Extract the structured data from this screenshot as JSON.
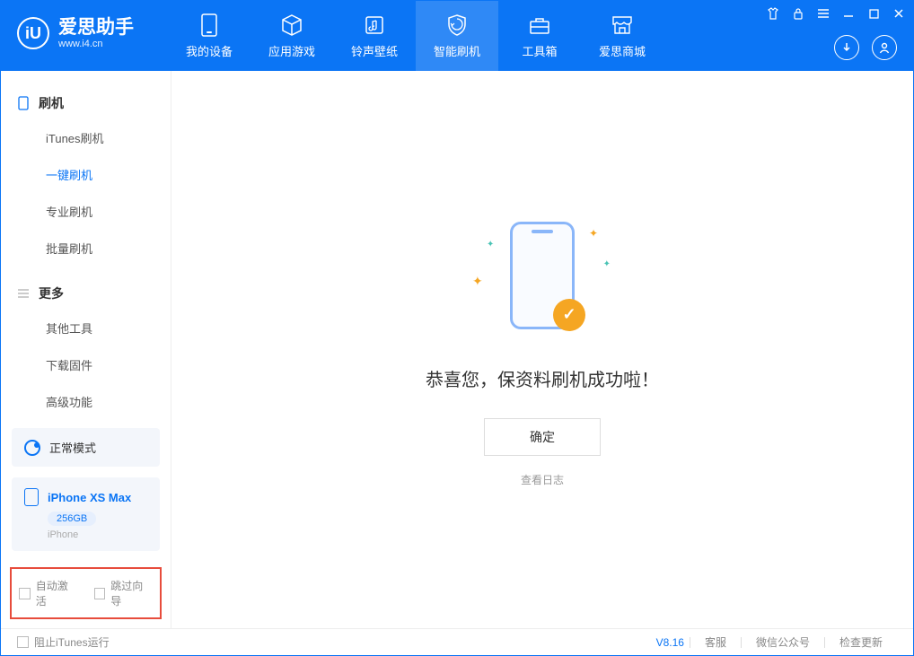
{
  "app": {
    "title": "爱思助手",
    "subtitle": "www.i4.cn",
    "logo_letter": "iU"
  },
  "nav": {
    "tabs": [
      {
        "label": "我的设备",
        "icon": "device"
      },
      {
        "label": "应用游戏",
        "icon": "cube"
      },
      {
        "label": "铃声壁纸",
        "icon": "music-folder"
      },
      {
        "label": "智能刷机",
        "icon": "shield",
        "active": true
      },
      {
        "label": "工具箱",
        "icon": "toolbox"
      },
      {
        "label": "爱思商城",
        "icon": "store"
      }
    ]
  },
  "sidebar": {
    "section1": {
      "title": "刷机"
    },
    "items1": [
      {
        "label": "iTunes刷机"
      },
      {
        "label": "一键刷机",
        "active": true
      },
      {
        "label": "专业刷机"
      },
      {
        "label": "批量刷机"
      }
    ],
    "section2": {
      "title": "更多"
    },
    "items2": [
      {
        "label": "其他工具"
      },
      {
        "label": "下载固件"
      },
      {
        "label": "高级功能"
      }
    ],
    "status": {
      "label": "正常模式"
    },
    "device": {
      "name": "iPhone XS Max",
      "storage": "256GB",
      "type": "iPhone"
    },
    "options": {
      "auto_activate": "自动激活",
      "skip_guide": "跳过向导"
    }
  },
  "main": {
    "success_title": "恭喜您，保资料刷机成功啦！",
    "confirm_label": "确定",
    "log_link": "查看日志"
  },
  "footer": {
    "block_itunes": "阻止iTunes运行",
    "version": "V8.16",
    "links": {
      "support": "客服",
      "wechat": "微信公众号",
      "update": "检查更新"
    }
  }
}
